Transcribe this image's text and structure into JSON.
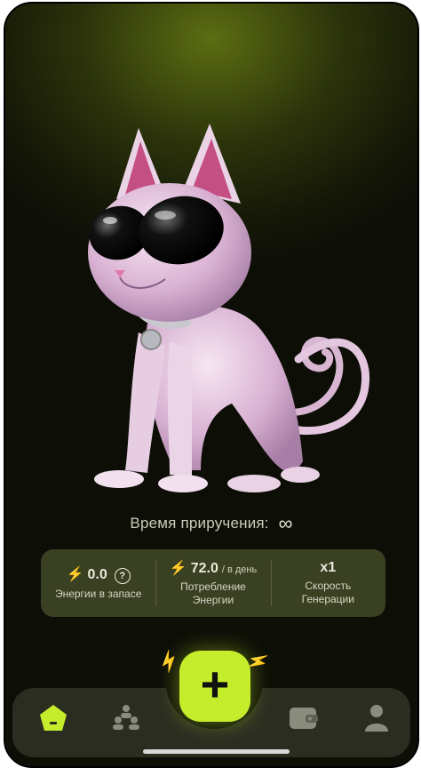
{
  "taming": {
    "label": "Время приручения:",
    "value": "∞"
  },
  "stats": [
    {
      "value": "0.0",
      "unit": "",
      "label": "Энергии в запасе",
      "has_bolt": true,
      "has_help": true
    },
    {
      "value": "72.0",
      "unit": "/ в день",
      "label": "Потребление Энергии",
      "has_bolt": true,
      "has_help": false
    },
    {
      "value": "x1",
      "unit": "",
      "label": "Скорость Генерации",
      "has_bolt": false,
      "has_help": false
    }
  ],
  "nav": {
    "items": [
      "home-icon",
      "referral-icon",
      "add-icon",
      "wallet-icon",
      "profile-icon"
    ],
    "active": "home-icon",
    "add_label": "+"
  },
  "colors": {
    "accent": "#c6ed2b",
    "background": "#0d0f07",
    "card": "#3a4022"
  }
}
